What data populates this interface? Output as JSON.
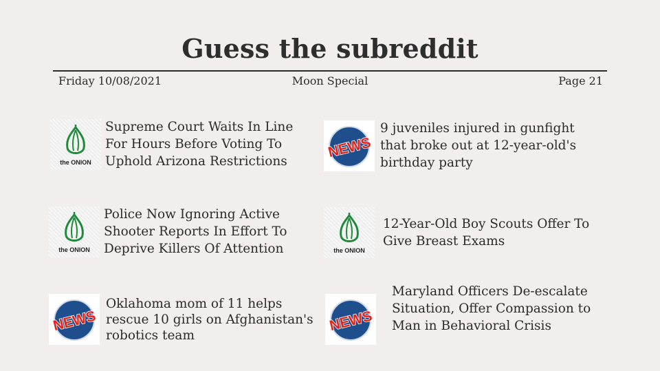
{
  "title": "Guess the subreddit",
  "header": {
    "date": "Friday 10/08/2021",
    "edition": "Moon Special",
    "page": "Page 21"
  },
  "logos": {
    "onion_text": "the ONION",
    "news_text": "NEWS"
  },
  "colors": {
    "onion_green": "#1f8a3a",
    "news_blue": "#1f4e8c",
    "news_red": "#e2231a"
  },
  "items": [
    {
      "logo": "onion",
      "headline": "Supreme Court Waits In Line For Hours Before Voting To Uphold Arizona Restrictions"
    },
    {
      "logo": "news",
      "headline": "9 juveniles injured in gunfight that broke out at 12-year-old's birthday party"
    },
    {
      "logo": "onion",
      "headline": "Police Now Ignoring Active Shooter Reports In Effort To Deprive Killers Of Attention"
    },
    {
      "logo": "onion",
      "headline": "12-Year-Old Boy Scouts Offer To Give Breast Exams"
    },
    {
      "logo": "news",
      "headline": "Oklahoma mom of 11 helps rescue 10 girls on Afghanistan's robotics team"
    },
    {
      "logo": "news",
      "headline": "Maryland Officers De-escalate Situation, Offer Compassion to Man in Behavioral Crisis"
    }
  ]
}
